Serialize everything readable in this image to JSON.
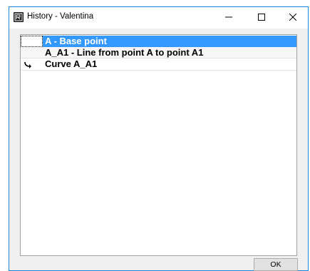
{
  "window": {
    "title": "History - Valentina",
    "accent_color": "#1883d7",
    "controls": {
      "minimize_icon": "minimize-icon",
      "maximize_icon": "maximize-icon",
      "close_icon": "close-icon"
    }
  },
  "history": {
    "items": [
      {
        "label": "A - Base point",
        "selected": true
      },
      {
        "label": "A_A1 - Line from point A to point A1",
        "selected": false
      },
      {
        "label": "Curve A_A1",
        "selected": false,
        "current": true,
        "marker_icon": "current-step-arrow-icon"
      }
    ],
    "selection_color": "#3399ff"
  },
  "footer": {
    "ok_label": "OK"
  }
}
